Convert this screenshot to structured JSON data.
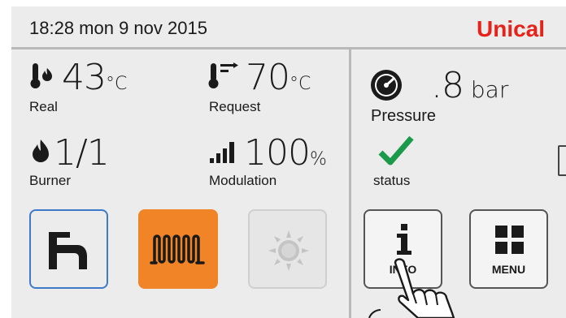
{
  "header": {
    "datetime": "18:28   mon 9 nov 2015",
    "brand": "Unical"
  },
  "metrics": {
    "real": {
      "value": "43",
      "unit": "°C",
      "label": "Real"
    },
    "request": {
      "value": "70",
      "unit": "°C",
      "label": "Request"
    },
    "burner": {
      "value": "1/1",
      "label": "Burner"
    },
    "modulation": {
      "value": "100",
      "unit": "%",
      "label": "Modulation"
    }
  },
  "pressure": {
    "value": ".8",
    "unit": "bar",
    "label": "Pressure"
  },
  "status": {
    "label": "status"
  },
  "buttons": {
    "info_label": "INFO",
    "menu_label": "MENU"
  },
  "colors": {
    "brand": "#e5231b",
    "heating_active": "#f08427",
    "status_ok": "#1a9a4a",
    "faucet_border": "#3d7ac9"
  }
}
